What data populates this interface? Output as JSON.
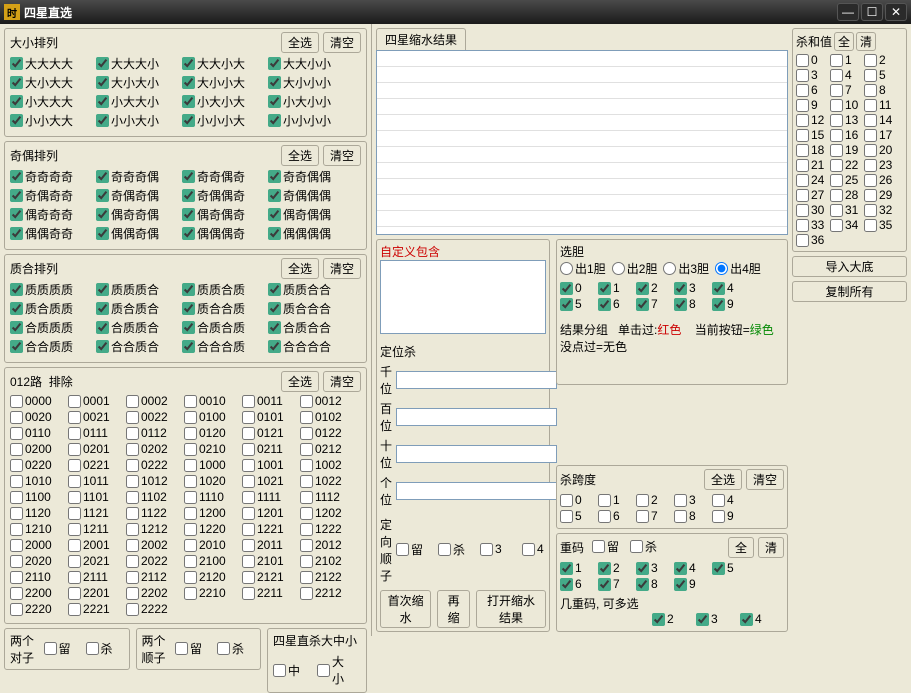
{
  "window": {
    "title": "四星直选",
    "icon": "时"
  },
  "common": {
    "select_all": "全选",
    "clear": "清空",
    "keep": "留",
    "kill": "杀",
    "all": "全",
    "clr": "清",
    "mid": "中",
    "big_small": "大小"
  },
  "daxiao": {
    "title": "大小排列",
    "items": [
      "大大大大",
      "大大大小",
      "大大小大",
      "大大小小",
      "大小大大",
      "大小大小",
      "大小小大",
      "大小小小",
      "小大大大",
      "小大大小",
      "小大小大",
      "小大小小",
      "小小大大",
      "小小大小",
      "小小小大",
      "小小小小"
    ]
  },
  "jiou": {
    "title": "奇偶排列",
    "items": [
      "奇奇奇奇",
      "奇奇奇偶",
      "奇奇偶奇",
      "奇奇偶偶",
      "奇偶奇奇",
      "奇偶奇偶",
      "奇偶偶奇",
      "奇偶偶偶",
      "偶奇奇奇",
      "偶奇奇偶",
      "偶奇偶奇",
      "偶奇偶偶",
      "偶偶奇奇",
      "偶偶奇偶",
      "偶偶偶奇",
      "偶偶偶偶"
    ]
  },
  "zhihe": {
    "title": "质合排列",
    "items": [
      "质质质质",
      "质质质合",
      "质质合质",
      "质质合合",
      "质合质质",
      "质合质合",
      "质合合质",
      "质合合合",
      "合质质质",
      "合质质合",
      "合质合质",
      "合质合合",
      "合合质质",
      "合合质合",
      "合合合质",
      "合合合合"
    ]
  },
  "lu012": {
    "title": "012路",
    "sub": "排除",
    "items": [
      "0000",
      "0001",
      "0002",
      "0010",
      "0011",
      "0012",
      "0020",
      "0021",
      "0022",
      "0100",
      "0101",
      "0102",
      "0110",
      "0111",
      "0112",
      "0120",
      "0121",
      "0122",
      "0200",
      "0201",
      "0202",
      "0210",
      "0211",
      "0212",
      "0220",
      "0221",
      "0222",
      "1000",
      "1001",
      "1002",
      "1010",
      "1011",
      "1012",
      "1020",
      "1021",
      "1022",
      "1100",
      "1101",
      "1102",
      "1110",
      "1111",
      "1112",
      "1120",
      "1121",
      "1122",
      "1200",
      "1201",
      "1202",
      "1210",
      "1211",
      "1212",
      "1220",
      "1221",
      "1222",
      "2000",
      "2001",
      "2002",
      "2010",
      "2011",
      "2012",
      "2020",
      "2021",
      "2022",
      "2100",
      "2101",
      "2102",
      "2110",
      "2111",
      "2112",
      "2120",
      "2121",
      "2122",
      "2200",
      "2201",
      "2202",
      "2210",
      "2211",
      "2212",
      "2220",
      "2221",
      "2222"
    ]
  },
  "pair": {
    "title": "两个对子"
  },
  "shunzi": {
    "title": "两个顺子"
  },
  "sha_dzx": {
    "title": "四星直杀大中小"
  },
  "result_tab": "四星缩水结果",
  "custom": {
    "title": "自定义包含",
    "pos_title": "定位杀",
    "qian": "千位",
    "bai": "百位",
    "shi": "十位",
    "ge": "个位",
    "dxsz": "定向顺子",
    "n3": "3",
    "n4": "4"
  },
  "dan": {
    "title": "选胆",
    "r1": "出1胆",
    "r2": "出2胆",
    "r3": "出3胆",
    "r4": "出4胆",
    "digits": [
      "0",
      "1",
      "2",
      "3",
      "4",
      "5",
      "6",
      "7",
      "8",
      "9"
    ],
    "group": "结果分组",
    "t1": "单击过:",
    "t1v": "红色",
    "t2": "当前按钮=",
    "t2v": "绿色",
    "t3": "没点过=无色"
  },
  "actions": {
    "first": "首次缩水",
    "again": "再缩",
    "open": "打开缩水结果",
    "import": "导入大底",
    "copy": "复制所有"
  },
  "shahezhi": {
    "title": "杀和值",
    "nums": [
      "0",
      "1",
      "2",
      "3",
      "4",
      "5",
      "6",
      "7",
      "8",
      "9",
      "10",
      "11",
      "12",
      "13",
      "14",
      "15",
      "16",
      "17",
      "18",
      "19",
      "20",
      "21",
      "22",
      "23",
      "24",
      "25",
      "26",
      "27",
      "28",
      "29",
      "30",
      "31",
      "32",
      "33",
      "34",
      "35",
      "36"
    ]
  },
  "kua": {
    "title": "杀跨度",
    "nums": [
      "0",
      "1",
      "2",
      "3",
      "4",
      "5",
      "6",
      "7",
      "8",
      "9"
    ]
  },
  "chong": {
    "title": "重码",
    "nums": [
      "1",
      "2",
      "3",
      "4",
      "5",
      "6",
      "7",
      "8",
      "9"
    ],
    "sub": "几重码, 可多选",
    "subnums": [
      "2",
      "3",
      "4"
    ]
  }
}
